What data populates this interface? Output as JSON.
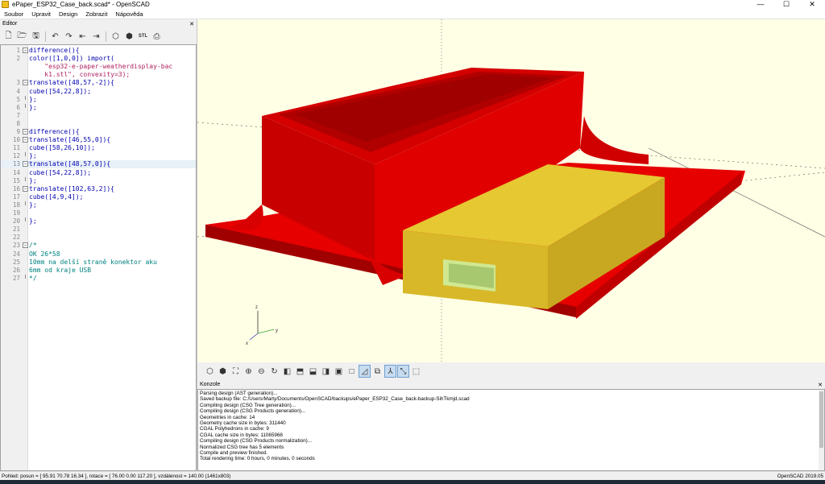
{
  "window": {
    "title": "ePaper_ESP32_Case_back.scad* - OpenSCAD",
    "minimize": "—",
    "maximize": "☐",
    "close": "✕"
  },
  "menu": [
    "Soubor",
    "Upravit",
    "Design",
    "Zobrazit",
    "Nápověda"
  ],
  "editor": {
    "title": "Editor",
    "close": "✕",
    "toolbar_icons": [
      "new-file-icon",
      "open-file-icon",
      "save-icon",
      "undo-icon",
      "redo-icon",
      "unindent-icon",
      "indent-icon",
      "preview-icon",
      "render-icon",
      "export-stl-icon",
      "send-to-print-icon"
    ],
    "lines": [
      {
        "n": "1",
        "fold": "minus",
        "t": "difference(){"
      },
      {
        "n": "2",
        "fold": "",
        "t": "color([1,0,0]) import("
      },
      {
        "n": "",
        "fold": "",
        "t": "    \"esp32-e-paper-weatherdisplay-bac"
      },
      {
        "n": "",
        "fold": "",
        "t": "    k1.stl\", convexity=3);"
      },
      {
        "n": "3",
        "fold": "minus",
        "t": "translate([48,57,-2]){"
      },
      {
        "n": "4",
        "fold": "",
        "t": "cube([54,22,8]);"
      },
      {
        "n": "5",
        "fold": "end",
        "t": "};"
      },
      {
        "n": "6",
        "fold": "end",
        "t": "};"
      },
      {
        "n": "7",
        "fold": "",
        "t": ""
      },
      {
        "n": "8",
        "fold": "",
        "t": ""
      },
      {
        "n": "9",
        "fold": "minus",
        "t": "difference(){"
      },
      {
        "n": "10",
        "fold": "minus",
        "t": "translate([46,55,0]){"
      },
      {
        "n": "11",
        "fold": "",
        "t": "cube([58,26,10]);"
      },
      {
        "n": "12",
        "fold": "end",
        "t": "};"
      },
      {
        "n": "13",
        "fold": "minus",
        "t": "translate([48,57,0]){"
      },
      {
        "n": "14",
        "fold": "",
        "t": "cube([54,22,8]);"
      },
      {
        "n": "15",
        "fold": "end",
        "t": "};"
      },
      {
        "n": "16",
        "fold": "minus",
        "t": "translate([102,63,2]){"
      },
      {
        "n": "17",
        "fold": "",
        "t": "cube([4,9,4]);"
      },
      {
        "n": "18",
        "fold": "end",
        "t": "};"
      },
      {
        "n": "19",
        "fold": "",
        "t": ""
      },
      {
        "n": "20",
        "fold": "end",
        "t": "};"
      },
      {
        "n": "21",
        "fold": "",
        "t": ""
      },
      {
        "n": "22",
        "fold": "",
        "t": ""
      },
      {
        "n": "23",
        "fold": "minus",
        "t": "/*"
      },
      {
        "n": "24",
        "fold": "",
        "t": "OK 26*58"
      },
      {
        "n": "25",
        "fold": "",
        "t": "10mm na delší straně konektor aku"
      },
      {
        "n": "26",
        "fold": "",
        "t": "6mm od kraje USB"
      },
      {
        "n": "27",
        "fold": "end",
        "t": "*/"
      }
    ],
    "highlighted_line": "13"
  },
  "view_toolbar_icons": [
    "preview-icon",
    "render-icon",
    "zoom-all-icon",
    "zoom-in-icon",
    "zoom-out-icon",
    "reset-view-icon",
    "view-right-icon",
    "view-top-icon",
    "view-bottom-icon",
    "view-left-icon",
    "view-front-icon",
    "view-back-icon",
    "perspective-icon",
    "orthogonal-icon",
    "show-axes-icon",
    "show-scale-markers-icon",
    "show-edges-icon"
  ],
  "console": {
    "title": "Konzole",
    "close": "✕",
    "lines": [
      "Parsing design (AST generation)...",
      "Saved backup file: C:/Users/Marty/Documents/OpenSCAD/backups/ePaper_ESP32_Case_back-backup-SihTkmjd.scad",
      "Compiling design (CSG Tree generation)...",
      "Compiling design (CSG Products generation)...",
      "Geometries in cache: 14",
      "Geometry cache size in bytes: 311440",
      "CGAL Polyhedrons in cache: 9",
      "CGAL cache size in bytes: 11065968",
      "Compiling design (CSG Products normalization)...",
      "Normalized CSG tree has 5 elements",
      "Compile and preview finished.",
      "Total rendering time: 0 hours, 0 minutes, 0 seconds"
    ]
  },
  "status": {
    "view_info": "Pohled: posun = [ 95.91 70.78 16.34 ], rotace = [ 76.00 0.00 117.20 ], vzdálenost = 140.00 (1461x803)",
    "version": "OpenSCAD 2019.05"
  },
  "colors": {
    "viewport_bg": "#ffffe6",
    "model_red": "#e60000",
    "model_yellow": "#e6c832",
    "accent": "#c8dcf0"
  }
}
